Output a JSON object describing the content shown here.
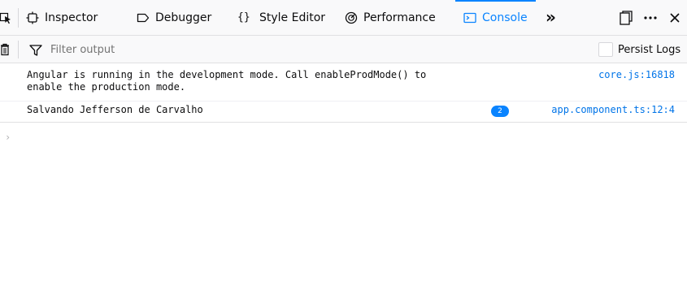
{
  "toolbar": {
    "tabs": [
      {
        "id": "inspector",
        "label": "Inspector",
        "icon": "inspector-icon"
      },
      {
        "id": "debugger",
        "label": "Debugger",
        "icon": "debugger-icon"
      },
      {
        "id": "style_editor",
        "label": "Style Editor",
        "icon": "braces-icon"
      },
      {
        "id": "performance",
        "label": "Performance",
        "icon": "stopwatch-icon"
      },
      {
        "id": "console",
        "label": "Console",
        "icon": "console-icon",
        "selected": true
      }
    ],
    "overflow_glyph": "»",
    "right_icons": [
      "dock-icon",
      "more-icon",
      "close-icon"
    ]
  },
  "filterbar": {
    "placeholder": "Filter output",
    "value": "",
    "persist_logs_label": "Persist Logs",
    "persist_logs_checked": false
  },
  "messages": [
    {
      "text": "Angular is running in the development mode. Call enableProdMode() to\nenable the production mode.",
      "location": "core.js:16818"
    },
    {
      "text": "Salvando Jefferson de Carvalho",
      "repeat_count": "2",
      "location": "app.component.ts:12:4"
    }
  ],
  "prompt": {
    "glyph": "›"
  },
  "colors": {
    "accent": "#0a84ff",
    "link": "#0074e8",
    "toolbar_bg": "#f9f9fa"
  }
}
